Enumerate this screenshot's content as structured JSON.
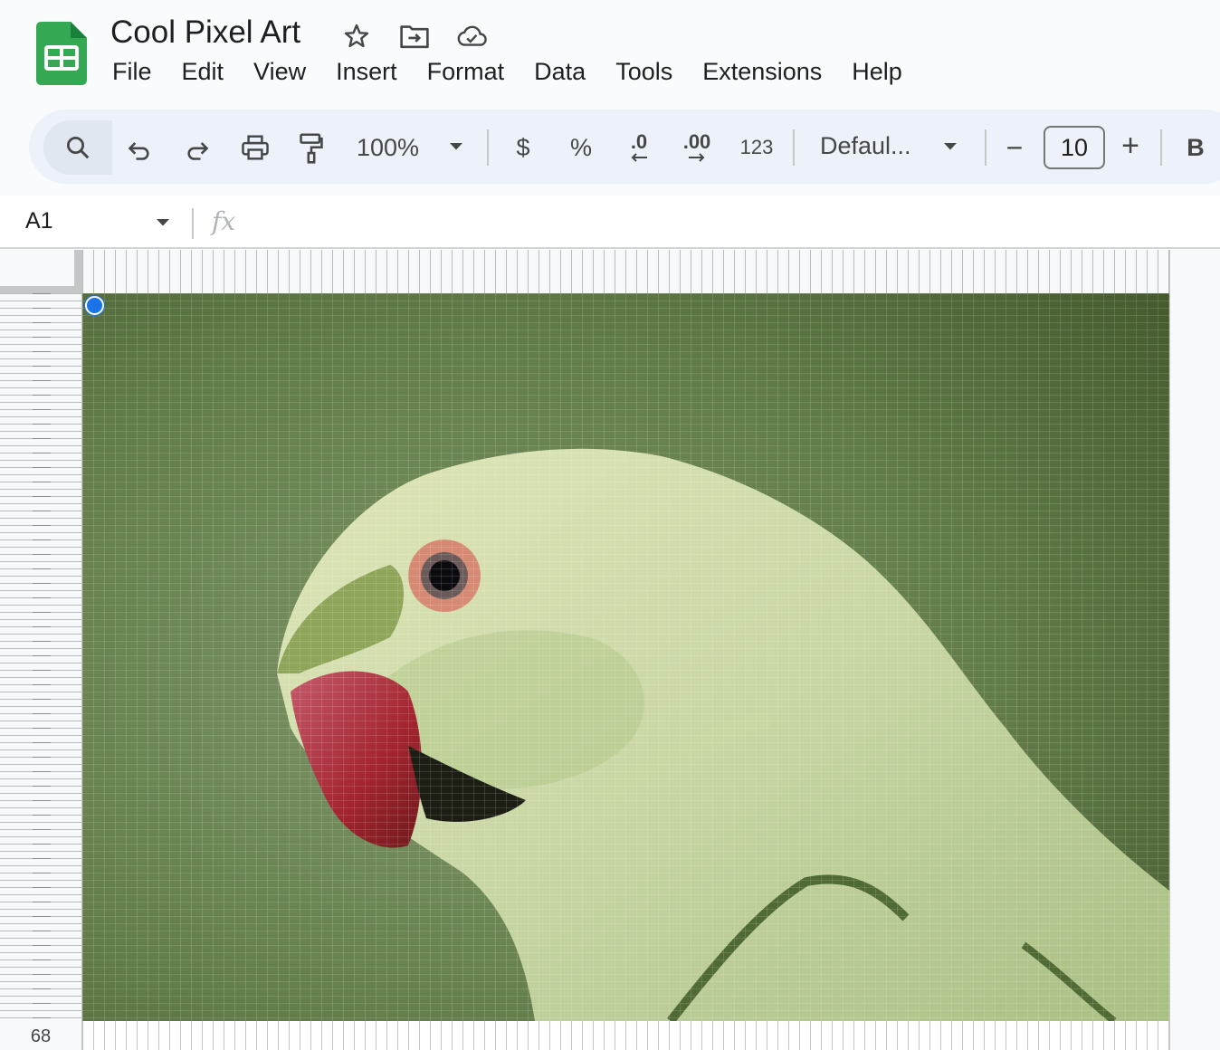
{
  "app": {
    "doc_title": "Cool Pixel Art",
    "icons": [
      "star-icon",
      "move-folder-icon",
      "cloud-saved-icon"
    ]
  },
  "menu": [
    "File",
    "Edit",
    "View",
    "Insert",
    "Format",
    "Data",
    "Tools",
    "Extensions",
    "Help"
  ],
  "toolbar": {
    "zoom": "100%",
    "currency": "$",
    "percent": "%",
    "decrease_decimal": ".0",
    "increase_decimal": ".00",
    "number_format": "123",
    "font": "Defaul...",
    "font_size": "10",
    "decrease_font": "−",
    "increase_font": "+",
    "bold": "B",
    "icons": [
      "search-icon",
      "undo-icon",
      "redo-icon",
      "print-icon",
      "paint-format-icon"
    ]
  },
  "formula_bar": {
    "name_box": "A1",
    "fx": "fx",
    "value": ""
  },
  "sheet": {
    "visible_row_label": "68",
    "selected_cell": "A1"
  },
  "colors": {
    "sheets_green": "#34a853",
    "selection_blue": "#1a73e8",
    "background_green": "#5d7a45",
    "beak_red": "#a5303c",
    "bird_pale_green": "#c9d9a5"
  }
}
